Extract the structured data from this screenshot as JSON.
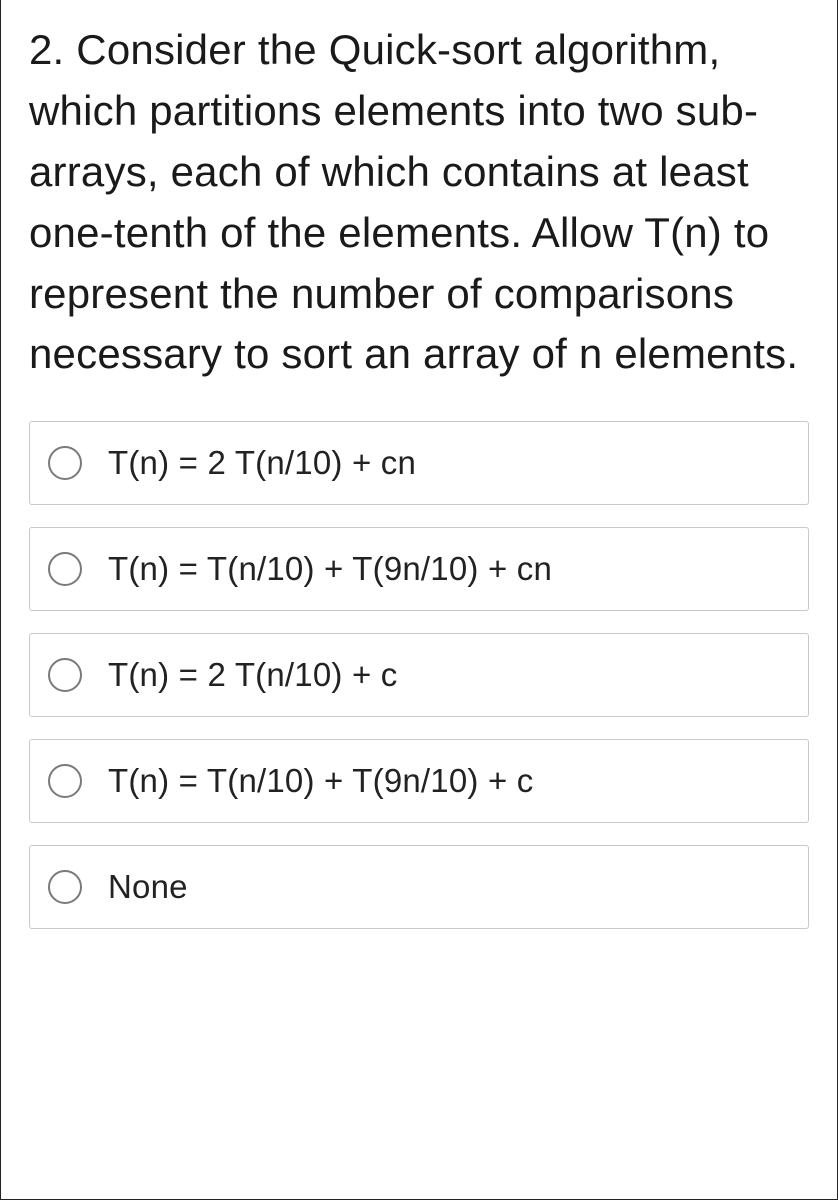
{
  "question": {
    "text": "2. Consider the Quick-sort algorithm, which partitions elements into two sub-arrays, each of which contains at least one-tenth of the elements. Allow T(n) to represent the number of comparisons necessary to sort an array of n elements."
  },
  "options": [
    {
      "label": "T(n) = 2 T(n/10) + cn"
    },
    {
      "label": "T(n) = T(n/10) + T(9n/10) + cn"
    },
    {
      "label": "T(n) = 2 T(n/10) + c"
    },
    {
      "label": "T(n) = T(n/10) + T(9n/10) + c"
    },
    {
      "label": "None"
    }
  ]
}
